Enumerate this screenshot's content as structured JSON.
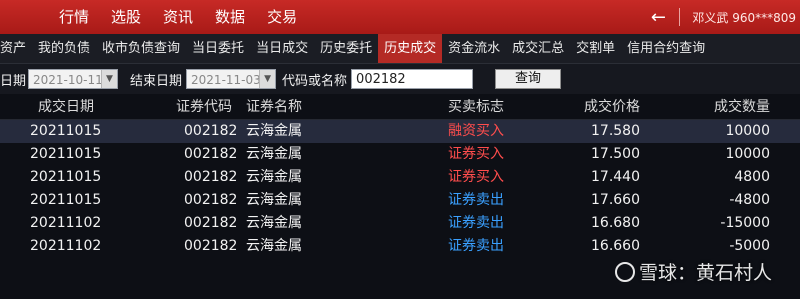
{
  "menu": {
    "items": [
      "行情",
      "选股",
      "资讯",
      "数据",
      "交易"
    ],
    "active_index": 4,
    "back_icon": "back-arrow-icon",
    "user": "邓义武 960***809"
  },
  "tabs": {
    "items": [
      "资产",
      "我的负债",
      "收市负债查询",
      "当日委托",
      "当日成交",
      "历史委托",
      "历史成交",
      "资金流水",
      "成交汇总",
      "交割单",
      "信用合约查询"
    ],
    "active_index": 6
  },
  "filter": {
    "start_label": "日期",
    "start_value": "2021-10-11",
    "end_label": "结束日期",
    "end_value": "2021-11-03",
    "code_label": "代码或名称",
    "code_value": "002182",
    "query_label": "查询"
  },
  "table": {
    "headers": [
      "成交日期",
      "证券代码",
      "证券名称",
      "买卖标志",
      "成交价格",
      "成交数量"
    ],
    "rows": [
      {
        "date": "20211015",
        "code": "002182",
        "name": "云海金属",
        "flag": "融资买入",
        "side": "buy",
        "price": "17.580",
        "qty": "10000"
      },
      {
        "date": "20211015",
        "code": "002182",
        "name": "云海金属",
        "flag": "证券买入",
        "side": "buy",
        "price": "17.500",
        "qty": "10000"
      },
      {
        "date": "20211015",
        "code": "002182",
        "name": "云海金属",
        "flag": "证券买入",
        "side": "buy",
        "price": "17.440",
        "qty": "4800"
      },
      {
        "date": "20211015",
        "code": "002182",
        "name": "云海金属",
        "flag": "证券卖出",
        "side": "sell",
        "price": "17.660",
        "qty": "-4800"
      },
      {
        "date": "20211102",
        "code": "002182",
        "name": "云海金属",
        "flag": "证券卖出",
        "side": "sell",
        "price": "16.680",
        "qty": "-15000"
      },
      {
        "date": "20211102",
        "code": "002182",
        "name": "云海金属",
        "flag": "证券卖出",
        "side": "sell",
        "price": "16.660",
        "qty": "-5000"
      }
    ],
    "selected_row": 0
  },
  "watermark": "雪球：黄石村人",
  "colors": {
    "menu_bg": "#b8211e",
    "active_tab": "#b42a25",
    "buy": "#ff4d4d",
    "sell": "#3aa0ff"
  }
}
